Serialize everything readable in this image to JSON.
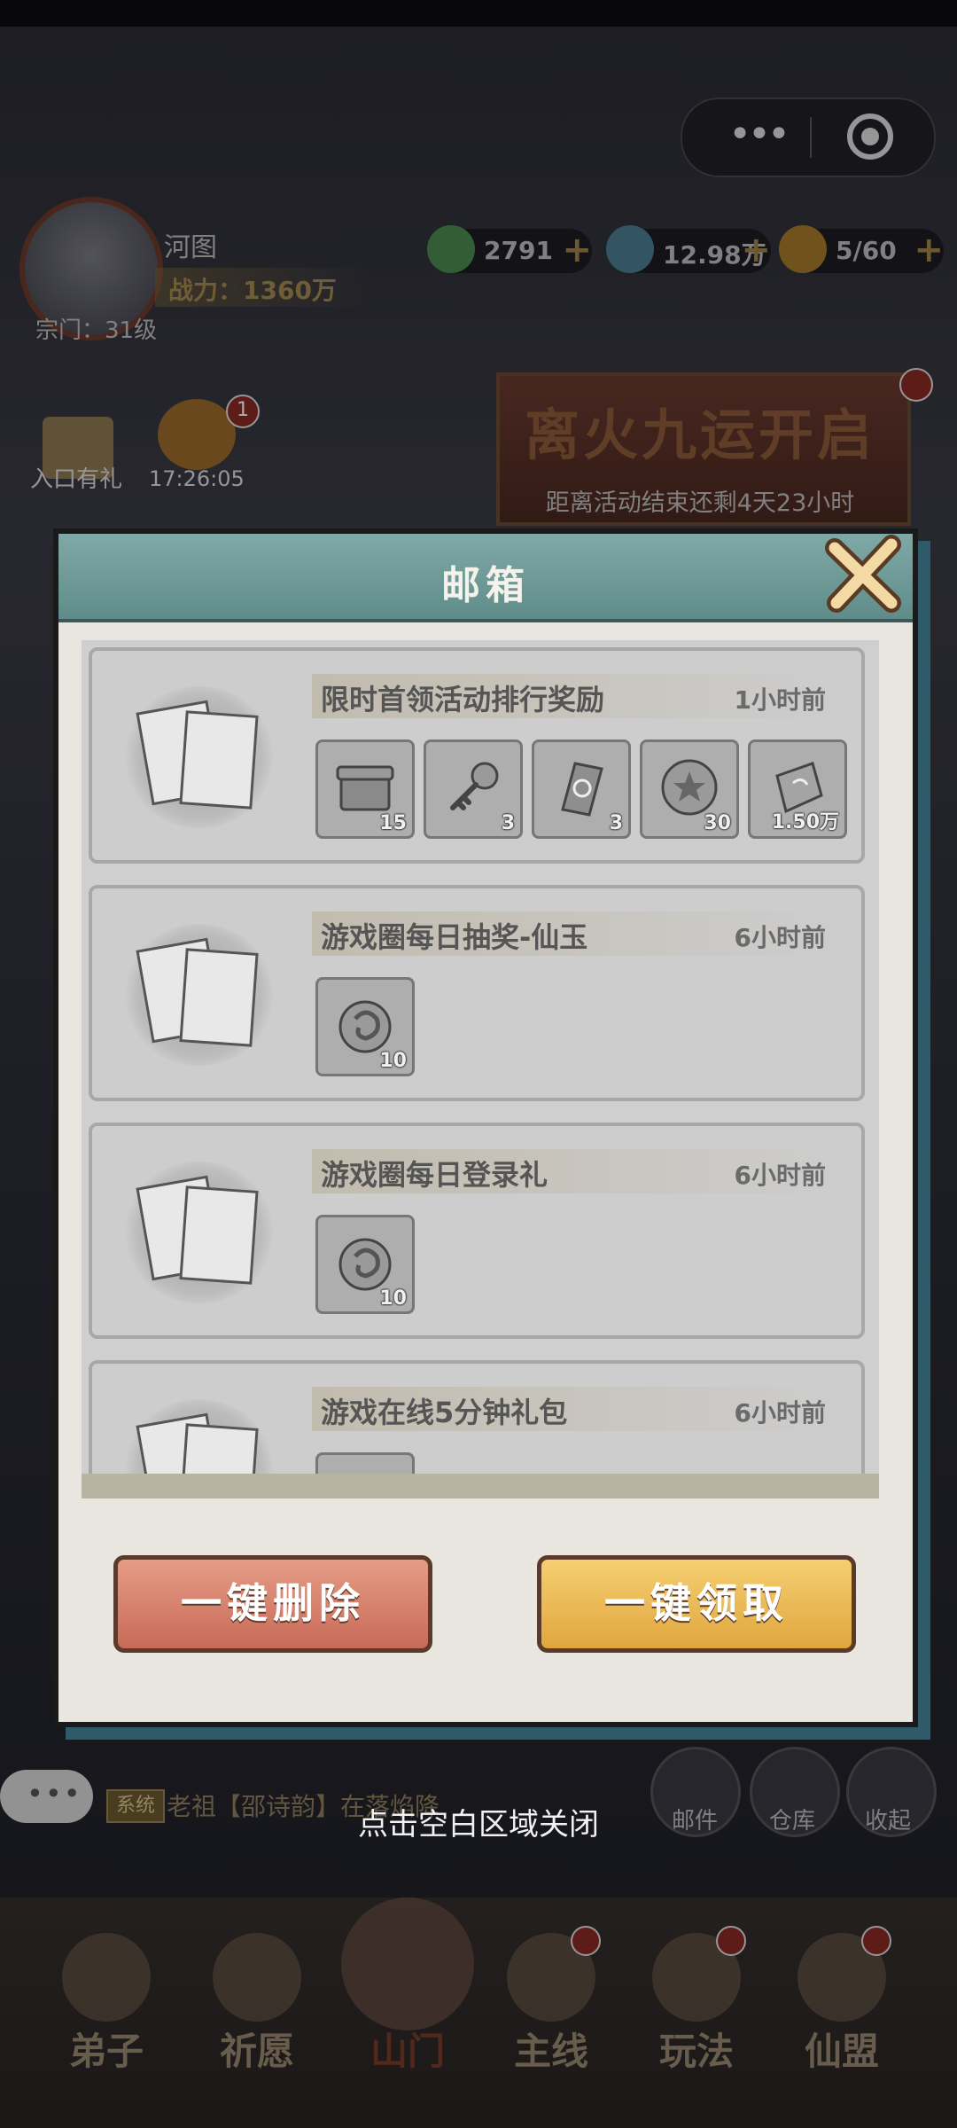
{
  "capsule": {
    "more_icon": "more-dots-icon",
    "record_icon": "record-target-icon"
  },
  "player": {
    "name": "河图",
    "power": "战力：1360万",
    "sect": "宗门：31级"
  },
  "resources": [
    {
      "icon": "jade-coin-icon",
      "value": "2791",
      "color": "#4c8a4e"
    },
    {
      "icon": "spirit-stone-icon",
      "value": "12.98万",
      "color": "#4b7c92"
    },
    {
      "icon": "stamina-gourd-icon",
      "value": "5/60",
      "color": "#a57b2a"
    }
  ],
  "activity": {
    "title": "离火九运开启",
    "subtitle": "距离活动结束还剩4天23小时"
  },
  "gifts": {
    "entry_gift": "入口有礼",
    "timer": "17:26:05",
    "timer_badge": "1"
  },
  "mailbox": {
    "title": "邮箱",
    "mails": [
      {
        "title": "限时首领活动排行奖励",
        "time": "1小时前",
        "items": [
          {
            "name": "chest-icon",
            "qty": "15"
          },
          {
            "name": "key-icon",
            "qty": "3"
          },
          {
            "name": "talisman-icon",
            "qty": "3"
          },
          {
            "name": "star-coin-icon",
            "qty": "30"
          },
          {
            "name": "crystal-icon",
            "qty": "1.50万"
          }
        ]
      },
      {
        "title": "游戏圈每日抽奖-仙玉",
        "time": "6小时前",
        "items": [
          {
            "name": "dragon-jade-icon",
            "qty": "10"
          }
        ]
      },
      {
        "title": "游戏圈每日登录礼",
        "time": "6小时前",
        "items": [
          {
            "name": "dragon-jade-icon",
            "qty": "10"
          }
        ]
      },
      {
        "title": "游戏在线5分钟礼包",
        "time": "6小时前",
        "items": [
          {
            "name": "dragon-jade-icon",
            "qty": ""
          }
        ]
      }
    ],
    "delete_all": "一键删除",
    "claim_all": "一键领取"
  },
  "chat": {
    "bubble": "•••",
    "tag": "系统",
    "message": "老祖【邵诗韵】在落焰降"
  },
  "side_buttons": [
    "邮件",
    "仓库",
    "收起"
  ],
  "close_hint": "点击空白区域关闭",
  "nav": [
    "弟子",
    "祈愿",
    "山门",
    "主线",
    "玩法",
    "仙盟"
  ]
}
